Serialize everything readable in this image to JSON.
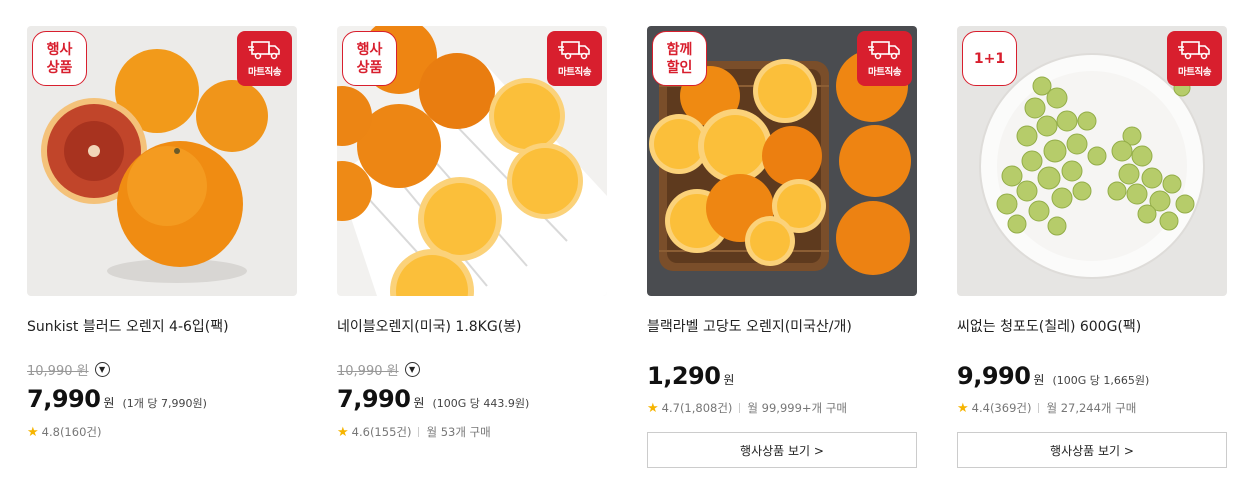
{
  "products": [
    {
      "badge": "행사\n상품",
      "ship_badge": "마트직송",
      "name": "Sunkist 블러드 오렌지 4-6입(팩)",
      "original_price": "10,990 원",
      "price": "7,990",
      "won": "원",
      "unit_price": "(1개 당 7,990원)",
      "rating": "4.8(160건)",
      "info_icon": "chevron-down-circle-icon"
    },
    {
      "badge": "행사\n상품",
      "ship_badge": "마트직송",
      "name": "네이블오렌지(미국) 1.8KG(봉)",
      "original_price": "10,990 원",
      "price": "7,990",
      "won": "원",
      "unit_price": "(100G 당 443.9원)",
      "rating": "4.6(155건)",
      "monthly_sales": "월 53개 구매",
      "info_icon": "chevron-down-circle-icon"
    },
    {
      "badge": "함께\n할인",
      "ship_badge": "마트직송",
      "name": "블랙라벨 고당도 오렌지(미국산/개)",
      "price": "1,290",
      "won": "원",
      "rating": "4.7(1,808건)",
      "monthly_sales": "월 99,999+개 구매",
      "button": "행사상품 보기 >"
    },
    {
      "badge": "1+1",
      "ship_badge": "마트직송",
      "name": "씨없는 청포도(칠레) 600G(팩)",
      "price": "9,990",
      "won": "원",
      "unit_price": "(100G 당 1,665원)",
      "rating": "4.4(369건)",
      "monthly_sales": "월 27,244개 구매",
      "button": "행사상품 보기 >"
    }
  ],
  "colors": {
    "accent": "#d81f2e",
    "star": "#f6b400"
  }
}
